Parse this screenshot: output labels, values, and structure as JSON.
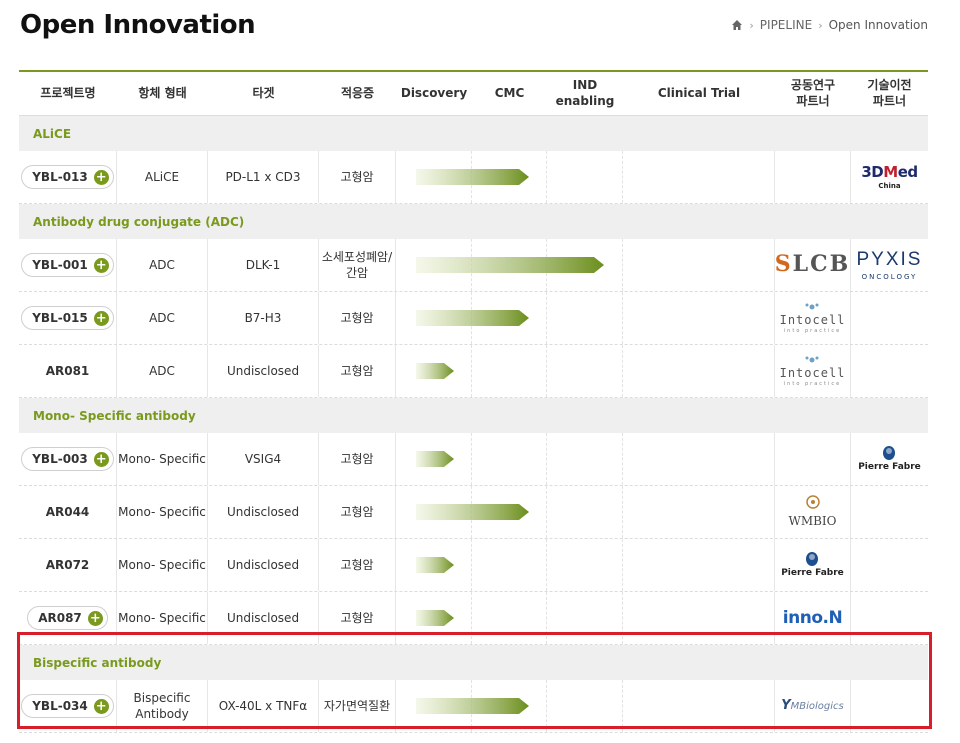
{
  "page": {
    "title": "Open Innovation"
  },
  "breadcrumb": {
    "items": [
      "PIPELINE",
      "Open Innovation"
    ]
  },
  "columns": [
    "프로젝트명",
    "항체 형태",
    "타겟",
    "적응증",
    "Discovery",
    "CMC",
    "IND\nenabling",
    "Clinical Trial",
    "공동연구\n파트너",
    "기술이전\n파트너"
  ],
  "groups": [
    {
      "label": "ALiCE",
      "rows": [
        {
          "code": "YBL-013",
          "plus": true,
          "format": "ALiCE",
          "target": "PD-L1 x CD3",
          "indication": "고형암",
          "stage": "CMC",
          "co_partner": "",
          "tt_partner": "3DMed China"
        }
      ]
    },
    {
      "label": "Antibody drug conjugate (ADC)",
      "rows": [
        {
          "code": "YBL-001",
          "plus": true,
          "format": "ADC",
          "target": "DLK-1",
          "indication": "소세포성폐암/\n간암",
          "stage": "IND enabling",
          "co_partner": "LCB LegoChemBio",
          "tt_partner": "PYXIS ONCOLOGY"
        },
        {
          "code": "YBL-015",
          "plus": true,
          "format": "ADC",
          "target": "B7-H3",
          "indication": "고형암",
          "stage": "CMC",
          "co_partner": "Intocell",
          "tt_partner": ""
        },
        {
          "code": "AR081",
          "plus": false,
          "format": "ADC",
          "target": "Undisclosed",
          "indication": "고형암",
          "stage": "Discovery",
          "co_partner": "Intocell",
          "tt_partner": ""
        }
      ]
    },
    {
      "label": "Mono- Specific antibody",
      "rows": [
        {
          "code": "YBL-003",
          "plus": true,
          "format": "Mono- Specific",
          "target": "VSIG4",
          "indication": "고형암",
          "stage": "Discovery",
          "co_partner": "",
          "tt_partner": "Pierre Fabre"
        },
        {
          "code": "AR044",
          "plus": false,
          "format": "Mono- Specific",
          "target": "Undisclosed",
          "indication": "고형암",
          "stage": "CMC",
          "co_partner": "WMBIO",
          "tt_partner": ""
        },
        {
          "code": "AR072",
          "plus": false,
          "format": "Mono- Specific",
          "target": "Undisclosed",
          "indication": "고형암",
          "stage": "Discovery",
          "co_partner": "Pierre Fabre",
          "tt_partner": ""
        },
        {
          "code": "AR087",
          "plus": true,
          "format": "Mono- Specific",
          "target": "Undisclosed",
          "indication": "고형암",
          "stage": "Discovery",
          "co_partner": "inno.N",
          "tt_partner": ""
        }
      ]
    },
    {
      "label": "Bispecific antibody",
      "rows": [
        {
          "code": "YBL-034",
          "plus": true,
          "format": "Bispecific\nAntibody",
          "target": "OX-40L x TNFα",
          "indication": "자가면역질환",
          "stage": "CMC",
          "co_partner": "YMBiologics",
          "tt_partner": ""
        }
      ]
    }
  ],
  "colors": {
    "accent": "#7a9a1e",
    "highlight_border": "#d71f2b"
  }
}
